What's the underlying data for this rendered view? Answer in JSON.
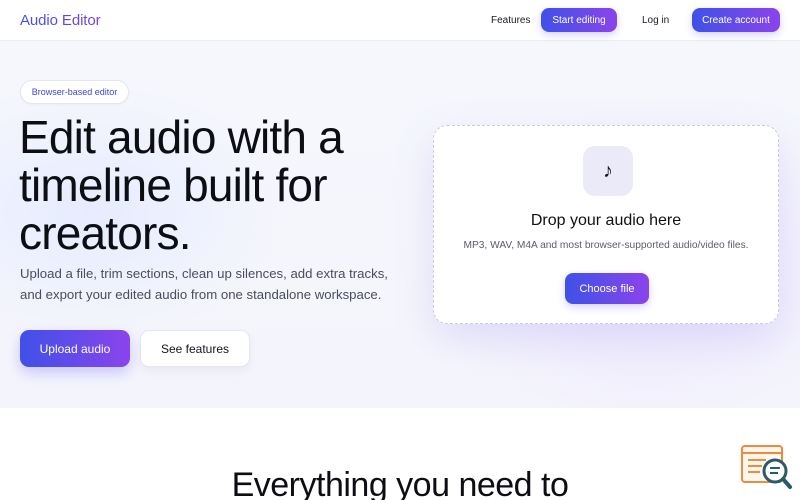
{
  "header": {
    "brand": "Audio Editor",
    "nav": {
      "features": "Features",
      "start_editing": "Start editing",
      "login": "Log in",
      "create_account": "Create account"
    }
  },
  "hero": {
    "badge": "Browser-based editor",
    "headline": "Edit audio with a timeline built for creators.",
    "subtext": "Upload a file, trim sections, clean up silences, add extra tracks, and export your edited audio from one standalone workspace.",
    "primary_button": "Upload audio",
    "secondary_button": "See features"
  },
  "dropzone": {
    "icon": "music-note-icon",
    "icon_glyph": "♪",
    "title": "Drop your audio here",
    "subtitle": "MP3, WAV, M4A and most browser-supported audio/video files.",
    "button": "Choose file"
  },
  "features_section": {
    "title": "Everything you need to"
  },
  "corner_widget": {
    "icon": "search-chat-icon"
  },
  "colors": {
    "accent_start": "#3f51e8",
    "accent_end": "#8b44ec",
    "badge_text": "#3a49c9",
    "widget_orange": "#f08a3c",
    "widget_teal": "#2a5b6a"
  }
}
